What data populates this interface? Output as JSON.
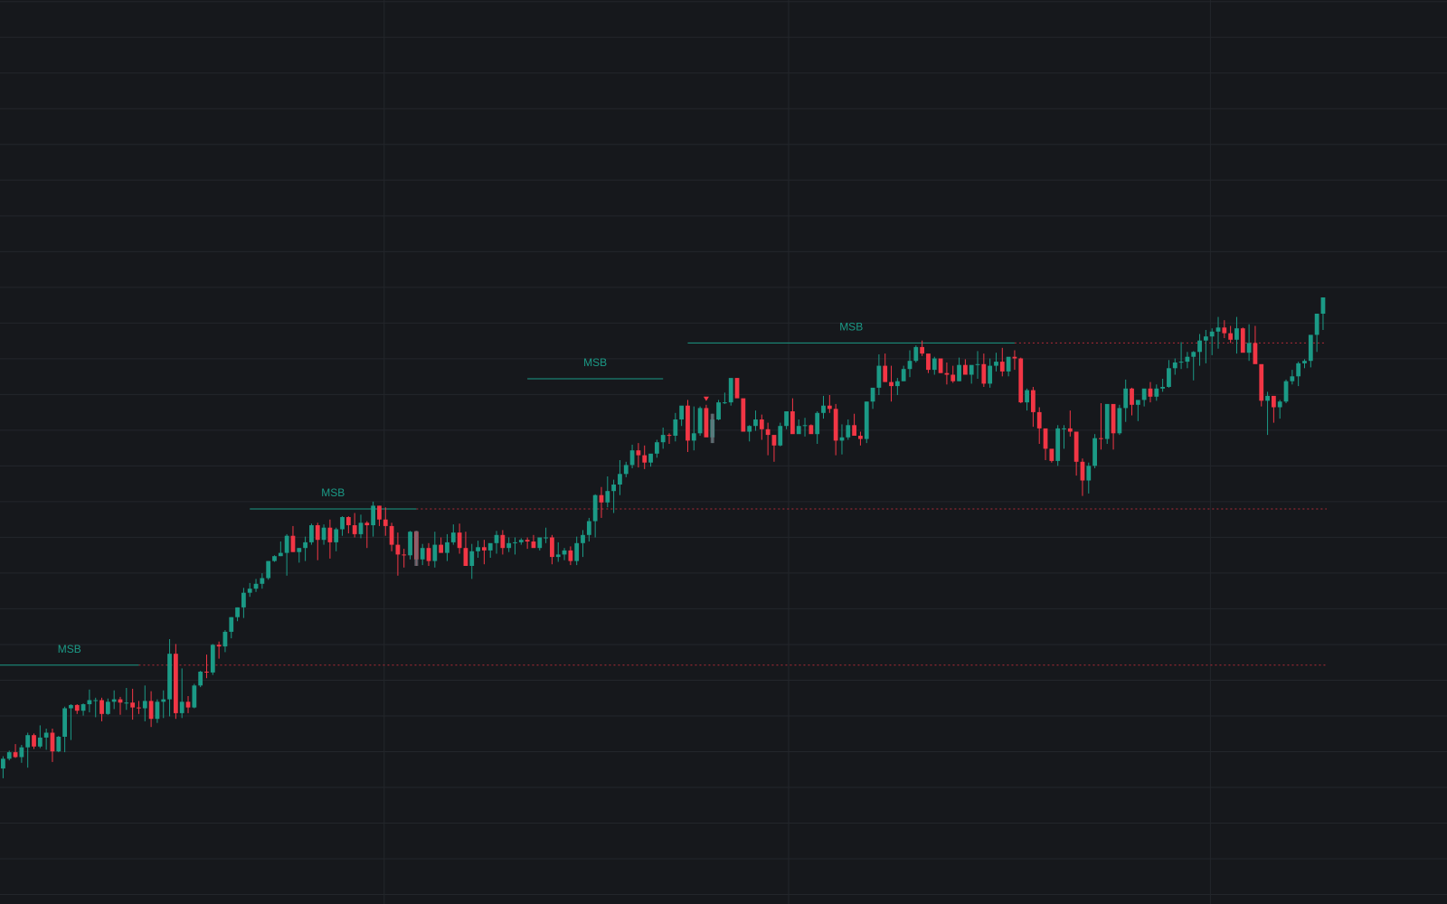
{
  "colors": {
    "background": "#16181c",
    "grid": "#23262b",
    "bull": "#1b9a86",
    "bear": "#f23645",
    "msb_line": "#1b9a86",
    "msb_text": "#1b9a86",
    "level_dotted": "#b02a37",
    "marker": "#f23645",
    "highlight": "#6b6f78"
  },
  "chart_data": {
    "type": "candlestick",
    "title": "",
    "xlabel": "",
    "ylabel": "",
    "grid": true,
    "legend": "none",
    "xlim": [
      0,
      200
    ],
    "ylim": [
      0,
      100
    ],
    "grid_x": [
      53.1,
      109,
      167.3
    ],
    "grid_y_step": 4.39,
    "ohlc": [
      [
        11.1,
        12.6,
        9.9,
        12.3
      ],
      [
        12.3,
        13.3,
        12.1,
        13.1
      ],
      [
        13.1,
        14.1,
        12.4,
        12.5
      ],
      [
        12.5,
        14.0,
        11.8,
        13.7
      ],
      [
        13.7,
        15.5,
        11.2,
        15.2
      ],
      [
        15.2,
        15.4,
        13.5,
        13.8
      ],
      [
        13.8,
        16.4,
        13.6,
        14.9
      ],
      [
        14.9,
        16.0,
        13.4,
        15.5
      ],
      [
        15.5,
        16.0,
        11.9,
        13.2
      ],
      [
        13.2,
        15.1,
        13.1,
        15.0
      ],
      [
        15.0,
        18.7,
        13.1,
        18.5
      ],
      [
        18.5,
        19.0,
        14.6,
        18.9
      ],
      [
        18.9,
        19.0,
        17.8,
        18.2
      ],
      [
        18.2,
        19.1,
        17.6,
        19.0
      ],
      [
        19.0,
        20.8,
        18.0,
        19.5
      ],
      [
        19.5,
        19.8,
        17.4,
        19.5
      ],
      [
        19.5,
        19.8,
        16.9,
        17.8
      ],
      [
        17.8,
        19.7,
        17.7,
        19.3
      ],
      [
        19.3,
        20.7,
        18.4,
        19.6
      ],
      [
        19.6,
        19.9,
        17.7,
        19.2
      ],
      [
        19.2,
        21.0,
        18.3,
        19.2
      ],
      [
        19.2,
        20.9,
        17.1,
        18.6
      ],
      [
        18.6,
        19.4,
        17.8,
        18.5
      ],
      [
        18.5,
        21.3,
        16.9,
        19.4
      ],
      [
        19.4,
        20.6,
        16.2,
        17.2
      ],
      [
        17.2,
        19.6,
        16.7,
        19.3
      ],
      [
        19.3,
        20.7,
        17.3,
        19.6
      ],
      [
        19.6,
        27.0,
        17.5,
        25.2
      ],
      [
        25.2,
        26.4,
        17.2,
        17.9
      ],
      [
        17.9,
        23.4,
        17.3,
        19.3
      ],
      [
        19.3,
        20.0,
        17.9,
        18.6
      ],
      [
        18.6,
        21.5,
        18.5,
        21.3
      ],
      [
        21.3,
        23.1,
        21.1,
        23.0
      ],
      [
        23.0,
        25.1,
        22.2,
        22.9
      ],
      [
        22.9,
        26.4,
        22.6,
        26.3
      ],
      [
        26.3,
        26.7,
        24.6,
        26.1
      ],
      [
        26.1,
        28.1,
        25.4,
        27.9
      ],
      [
        27.9,
        29.7,
        27.1,
        29.7
      ],
      [
        29.7,
        30.9,
        29.2,
        30.9
      ],
      [
        30.9,
        33.3,
        29.6,
        32.7
      ],
      [
        32.7,
        33.9,
        32.2,
        33.2
      ],
      [
        33.2,
        34.4,
        32.8,
        33.8
      ],
      [
        33.8,
        35.1,
        33.2,
        34.5
      ],
      [
        34.5,
        36.6,
        34.3,
        36.6
      ],
      [
        36.6,
        37.3,
        36.5,
        37.2
      ],
      [
        37.2,
        39.0,
        37.2,
        37.6
      ],
      [
        37.6,
        39.9,
        34.8,
        39.7
      ],
      [
        39.7,
        40.9,
        37.7,
        37.7
      ],
      [
        37.7,
        38.2,
        36.4,
        38.2
      ],
      [
        38.2,
        39.6,
        36.6,
        38.9
      ],
      [
        38.9,
        41.2,
        38.6,
        41.0
      ],
      [
        41.0,
        41.3,
        36.7,
        39.2
      ],
      [
        39.2,
        41.1,
        38.6,
        40.7
      ],
      [
        40.7,
        41.7,
        36.9,
        38.9
      ],
      [
        38.9,
        40.7,
        37.8,
        40.5
      ],
      [
        40.5,
        42.1,
        39.7,
        42.0
      ],
      [
        42.0,
        42.1,
        40.0,
        41.0
      ],
      [
        41.0,
        42.5,
        39.5,
        39.9
      ],
      [
        39.9,
        42.3,
        39.4,
        41.3
      ],
      [
        41.3,
        41.5,
        38.2,
        41.0
      ],
      [
        41.0,
        43.9,
        39.6,
        43.4
      ],
      [
        43.4,
        43.4,
        40.9,
        41.7
      ],
      [
        41.7,
        43.2,
        39.7,
        40.9
      ],
      [
        40.9,
        41.3,
        37.8,
        38.6
      ],
      [
        38.6,
        40.1,
        34.8,
        37.4
      ],
      [
        37.4,
        38.1,
        35.8,
        37.3
      ],
      [
        37.3,
        40.3,
        36.8,
        40.2
      ],
      [
        40.2,
        40.3,
        36.0,
        36.8
      ],
      [
        36.8,
        38.7,
        36.1,
        38.2
      ],
      [
        38.2,
        38.8,
        36.0,
        36.6
      ],
      [
        36.6,
        40.2,
        35.8,
        38.6
      ],
      [
        38.6,
        39.5,
        37.6,
        37.6
      ],
      [
        37.6,
        39.9,
        36.6,
        38.9
      ],
      [
        38.9,
        41.1,
        38.6,
        40.1
      ],
      [
        40.1,
        41.2,
        37.5,
        38.2
      ],
      [
        38.2,
        40.2,
        36.6,
        36.0
      ],
      [
        36.0,
        38.7,
        34.4,
        37.8
      ],
      [
        37.8,
        39.1,
        37.0,
        38.3
      ],
      [
        38.3,
        39.2,
        36.2,
        37.9
      ],
      [
        37.9,
        38.7,
        37.0,
        38.8
      ],
      [
        38.8,
        40.3,
        37.5,
        39.8
      ],
      [
        39.8,
        40.4,
        37.4,
        38.2
      ],
      [
        38.2,
        39.5,
        37.7,
        38.8
      ],
      [
        38.8,
        39.5,
        37.4,
        38.9
      ],
      [
        38.9,
        39.4,
        38.6,
        39.2
      ],
      [
        39.2,
        39.5,
        38.1,
        39.0
      ],
      [
        39.0,
        39.8,
        38.5,
        38.2
      ],
      [
        38.2,
        39.5,
        37.9,
        39.5
      ],
      [
        39.5,
        40.7,
        38.8,
        39.5
      ],
      [
        39.5,
        39.8,
        36.2,
        37.1
      ],
      [
        37.1,
        38.9,
        36.5,
        37.4
      ],
      [
        37.4,
        38.2,
        36.7,
        37.9
      ],
      [
        37.9,
        38.4,
        36.1,
        36.6
      ],
      [
        36.6,
        39.6,
        36.1,
        38.8
      ],
      [
        38.8,
        40.4,
        37.1,
        39.8
      ],
      [
        39.8,
        41.9,
        39.0,
        41.5
      ],
      [
        41.5,
        44.8,
        39.5,
        44.7
      ],
      [
        44.7,
        45.7,
        41.9,
        43.8
      ],
      [
        43.8,
        47.0,
        43.2,
        45.2
      ],
      [
        45.2,
        46.6,
        42.5,
        46.0
      ],
      [
        46.0,
        49.0,
        44.7,
        47.3
      ],
      [
        47.3,
        48.8,
        46.9,
        48.4
      ],
      [
        48.4,
        50.9,
        48.0,
        50.2
      ],
      [
        50.2,
        51.1,
        48.1,
        49.6
      ],
      [
        49.6,
        50.8,
        47.9,
        48.7
      ],
      [
        48.7,
        49.7,
        48.2,
        49.8
      ],
      [
        49.8,
        51.5,
        49.3,
        51.2
      ],
      [
        51.2,
        53.0,
        50.4,
        52.1
      ],
      [
        52.1,
        52.3,
        51.0,
        52.0
      ],
      [
        52.0,
        54.8,
        51.3,
        54.0
      ],
      [
        54.0,
        55.6,
        53.2,
        55.7
      ],
      [
        55.7,
        56.4,
        50.0,
        51.4
      ],
      [
        51.4,
        55.6,
        50.2,
        52.3
      ],
      [
        52.3,
        55.6,
        52.0,
        55.4
      ],
      [
        55.4,
        55.8,
        52.3,
        51.8
      ],
      [
        51.8,
        54.7,
        51.1,
        54.0
      ],
      [
        54.0,
        56.4,
        53.9,
        56.1
      ],
      [
        56.1,
        57.3,
        55.9,
        56.1
      ],
      [
        56.1,
        59.0,
        55.7,
        59.1
      ],
      [
        59.1,
        59.1,
        56.8,
        56.6
      ],
      [
        56.6,
        55.7,
        52.6,
        52.5
      ],
      [
        52.5,
        53.3,
        51.3,
        53.2
      ],
      [
        53.2,
        55.1,
        52.6,
        54.0
      ],
      [
        54.0,
        54.6,
        51.5,
        52.8
      ],
      [
        52.8,
        53.6,
        49.6,
        52.1
      ],
      [
        52.1,
        51.6,
        48.8,
        50.8
      ],
      [
        50.8,
        53.6,
        50.7,
        53.2
      ],
      [
        53.2,
        54.8,
        52.8,
        55.0
      ],
      [
        55.0,
        56.6,
        52.8,
        52.2
      ],
      [
        52.2,
        54.0,
        52.4,
        53.2
      ],
      [
        53.2,
        54.2,
        51.9,
        53.3
      ],
      [
        53.3,
        53.4,
        52.4,
        52.2
      ],
      [
        52.2,
        55.0,
        51.0,
        54.8
      ],
      [
        54.8,
        56.9,
        54.1,
        55.7
      ],
      [
        55.7,
        57.0,
        54.8,
        55.3
      ],
      [
        55.3,
        55.9,
        49.6,
        51.4
      ],
      [
        51.4,
        53.4,
        49.7,
        51.8
      ],
      [
        51.8,
        54.0,
        51.5,
        53.3
      ],
      [
        53.3,
        54.7,
        52.2,
        52.0
      ],
      [
        52.0,
        52.5,
        50.8,
        51.6
      ],
      [
        51.6,
        56.2,
        51.1,
        56.2
      ],
      [
        56.2,
        57.6,
        55.3,
        57.9
      ],
      [
        57.9,
        62.0,
        57.0,
        60.6
      ],
      [
        60.6,
        62.1,
        58.6,
        58.6
      ],
      [
        58.6,
        60.6,
        56.2,
        58.1
      ],
      [
        58.1,
        59.1,
        57.0,
        58.7
      ],
      [
        58.7,
        60.6,
        58.7,
        60.2
      ],
      [
        60.2,
        62.5,
        59.2,
        61.2
      ],
      [
        61.2,
        63.1,
        61.0,
        62.9
      ],
      [
        62.9,
        63.7,
        61.8,
        62.1
      ],
      [
        62.1,
        61.5,
        59.7,
        60.1
      ],
      [
        60.1,
        61.7,
        59.5,
        61.5
      ],
      [
        61.5,
        60.3,
        59.7,
        59.7
      ],
      [
        59.7,
        61.0,
        58.3,
        59.5
      ],
      [
        59.5,
        60.6,
        58.5,
        58.7
      ],
      [
        58.7,
        61.6,
        58.7,
        60.7
      ],
      [
        60.7,
        61.4,
        59.6,
        59.5
      ],
      [
        59.5,
        60.5,
        58.4,
        60.7
      ],
      [
        60.7,
        62.4,
        59.0,
        60.8
      ],
      [
        60.8,
        62.1,
        58.0,
        58.4
      ],
      [
        58.4,
        61.5,
        57.9,
        60.6
      ],
      [
        60.6,
        62.2,
        59.9,
        61.1
      ],
      [
        61.1,
        62.8,
        59.3,
        59.9
      ],
      [
        59.9,
        61.3,
        59.3,
        61.7
      ],
      [
        61.7,
        62.5,
        60.1,
        61.5
      ],
      [
        61.5,
        61.6,
        56.0,
        56.1
      ],
      [
        56.1,
        57.8,
        55.1,
        57.6
      ],
      [
        57.6,
        58.0,
        53.1,
        54.9
      ],
      [
        54.9,
        55.5,
        51.0,
        52.9
      ],
      [
        52.9,
        51.7,
        49.0,
        50.4
      ],
      [
        50.4,
        49.8,
        48.7,
        48.9
      ],
      [
        48.9,
        53.3,
        48.3,
        52.9
      ],
      [
        52.9,
        53.3,
        50.4,
        52.9
      ],
      [
        52.9,
        55.1,
        51.9,
        52.5
      ],
      [
        52.5,
        51.5,
        47.1,
        48.8
      ],
      [
        48.8,
        49.2,
        44.6,
        46.5
      ],
      [
        46.5,
        48.7,
        44.9,
        48.3
      ],
      [
        48.3,
        52.2,
        48.0,
        51.7
      ],
      [
        51.7,
        56.0,
        50.3,
        51.6
      ],
      [
        51.6,
        55.5,
        51.0,
        55.9
      ],
      [
        55.9,
        52.6,
        50.3,
        52.3
      ],
      [
        52.3,
        55.8,
        52.1,
        55.4
      ],
      [
        55.4,
        58.9,
        53.7,
        57.8
      ],
      [
        57.8,
        57.9,
        54.5,
        55.8
      ],
      [
        55.8,
        56.0,
        53.8,
        56.4
      ],
      [
        56.4,
        57.0,
        55.6,
        57.8
      ],
      [
        57.8,
        58.6,
        56.1,
        56.8
      ],
      [
        56.8,
        58.3,
        56.3,
        57.8
      ],
      [
        57.8,
        59.0,
        57.4,
        58.0
      ],
      [
        58.0,
        61.3,
        57.9,
        60.3
      ],
      [
        60.3,
        61.5,
        59.5,
        61.0
      ],
      [
        61.0,
        63.5,
        60.2,
        61.1
      ],
      [
        61.1,
        62.3,
        60.3,
        61.7
      ],
      [
        61.7,
        62.4,
        58.8,
        62.3
      ],
      [
        62.3,
        64.5,
        60.6,
        63.7
      ],
      [
        63.7,
        65.0,
        60.9,
        64.2
      ],
      [
        64.2,
        65.2,
        61.9,
        64.8
      ],
      [
        64.8,
        66.6,
        62.7,
        65.3
      ],
      [
        65.3,
        66.2,
        64.0,
        64.6
      ],
      [
        64.6,
        65.5,
        63.4,
        63.8
      ],
      [
        63.8,
        66.6,
        62.1,
        65.2
      ],
      [
        65.2,
        65.3,
        63.4,
        62.2
      ],
      [
        62.2,
        65.7,
        61.2,
        63.4
      ],
      [
        63.4,
        65.5,
        61.6,
        60.8
      ],
      [
        60.8,
        59.9,
        55.6,
        56.3
      ],
      [
        56.3,
        57.4,
        52.1,
        56.9
      ],
      [
        56.9,
        56.2,
        53.6,
        55.5
      ],
      [
        55.5,
        56.4,
        54.1,
        56.2
      ],
      [
        56.2,
        58.9,
        56.0,
        58.7
      ],
      [
        58.7,
        60.1,
        58.3,
        59.3
      ],
      [
        59.3,
        61.1,
        58.1,
        60.9
      ],
      [
        60.9,
        61.4,
        60.3,
        61.2
      ],
      [
        61.2,
        62.4,
        60.4,
        64.4
      ],
      [
        64.4,
        66.8,
        62.3,
        67.0
      ],
      [
        67.0,
        69.0,
        65.0,
        69.0
      ]
    ],
    "msb_annotations": [
      {
        "label": "MSB",
        "from_x": 0,
        "to_x": 22,
        "level": 23.8
      },
      {
        "label": "MSB",
        "from_x": 40,
        "to_x": 67,
        "level": 43.0
      },
      {
        "label": "MSB",
        "from_x": 85,
        "to_x": 107,
        "level": 59.0
      },
      {
        "label": "MSB",
        "from_x": 111,
        "to_x": 164,
        "level": 63.4
      }
    ],
    "dotted_levels": [
      23.8,
      43.0,
      63.4
    ]
  }
}
